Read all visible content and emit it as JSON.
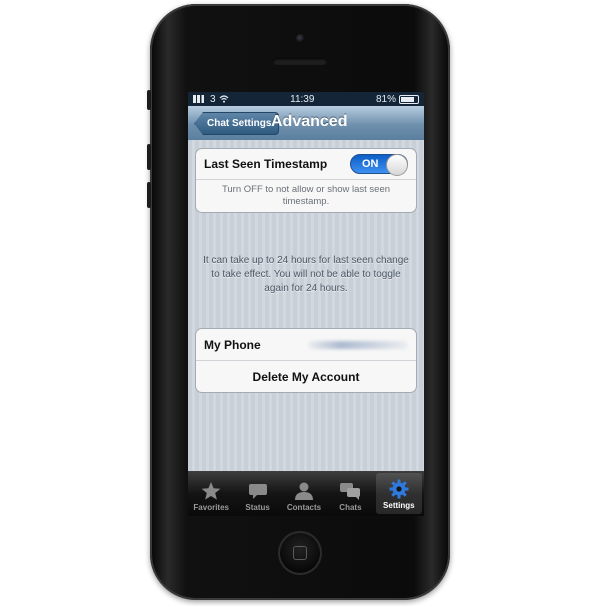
{
  "status_bar": {
    "carrier": "3",
    "time": "11:39",
    "battery": "81%"
  },
  "navbar": {
    "back_label": "Chat Settings",
    "title": "Advanced"
  },
  "last_seen": {
    "title": "Last Seen Timestamp",
    "toggle_state": "ON",
    "footer": "Turn OFF to not allow or show last seen timestamp."
  },
  "note": "It can take up to 24 hours for last seen change to take effect. You will not be able to toggle again for 24 hours.",
  "account": {
    "my_phone_label": "My Phone",
    "delete_label": "Delete My Account"
  },
  "tabs": [
    {
      "label": "Favorites",
      "icon": "star-icon"
    },
    {
      "label": "Status",
      "icon": "speech-bubble-icon"
    },
    {
      "label": "Contacts",
      "icon": "person-icon"
    },
    {
      "label": "Chats",
      "icon": "chats-icon"
    },
    {
      "label": "Settings",
      "icon": "gear-icon",
      "active": true
    }
  ],
  "colors": {
    "accent": "#2f79dd",
    "navbar": "#6f90ad",
    "tabbar": "#141414"
  }
}
